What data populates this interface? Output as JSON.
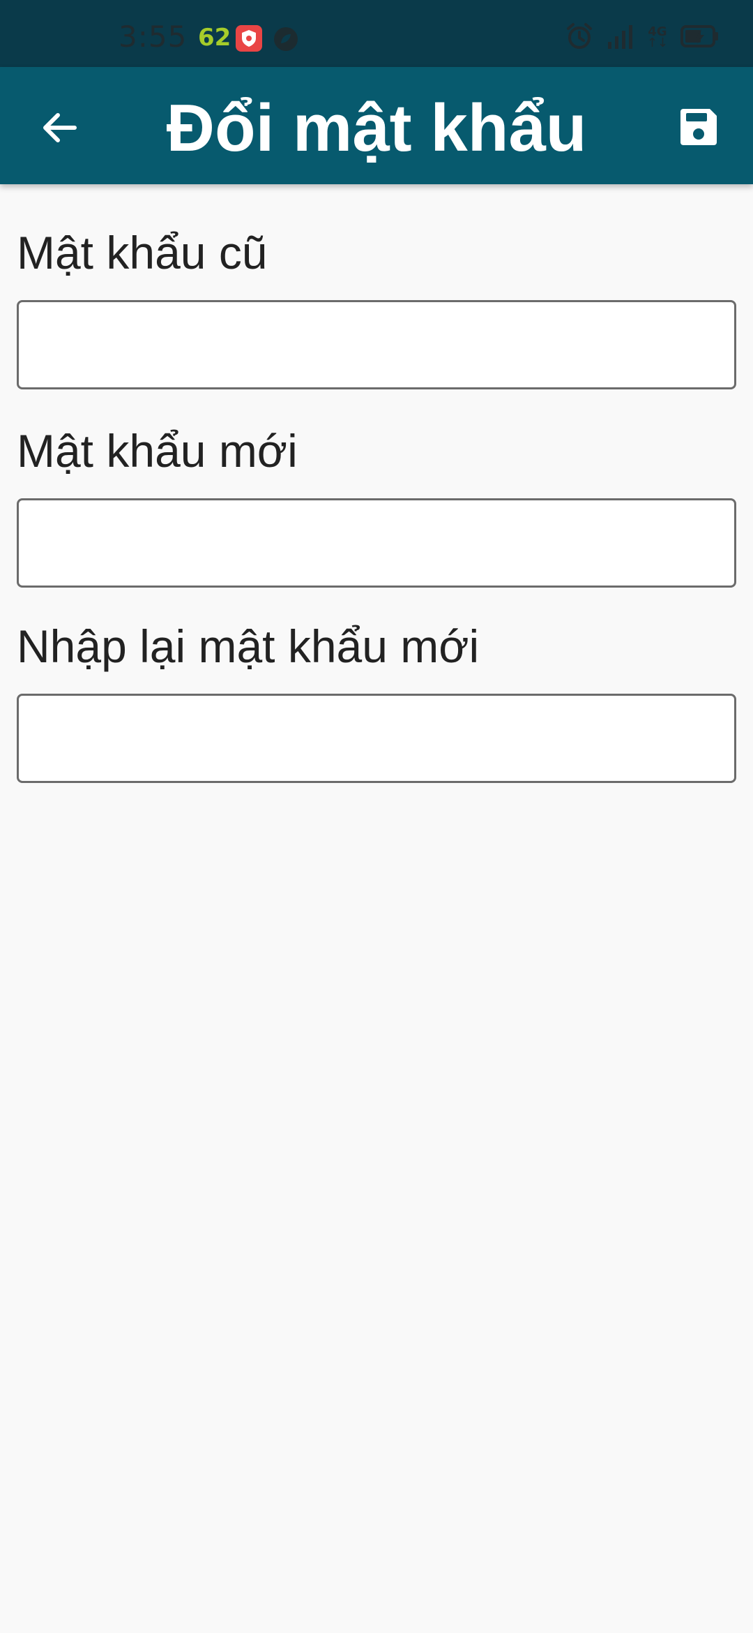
{
  "status_bar": {
    "time": "3:55",
    "badge_number": "62",
    "network_type": "4G",
    "icons": [
      "shield-notification-icon",
      "circle-app-icon",
      "alarm-icon",
      "signal-icon",
      "network-4g-icon",
      "battery-charging-icon"
    ]
  },
  "app_bar": {
    "title": "Đổi mật khẩu",
    "back_icon": "arrow-back-icon",
    "save_icon": "floppy-disk-icon",
    "background_color": "#075a6e"
  },
  "form": {
    "fields": [
      {
        "label": "Mật khẩu cũ",
        "value": "",
        "placeholder": ""
      },
      {
        "label": "Mật khẩu mới",
        "value": "",
        "placeholder": ""
      },
      {
        "label": "Nhập lại mật khẩu mới",
        "value": "",
        "placeholder": ""
      }
    ]
  }
}
